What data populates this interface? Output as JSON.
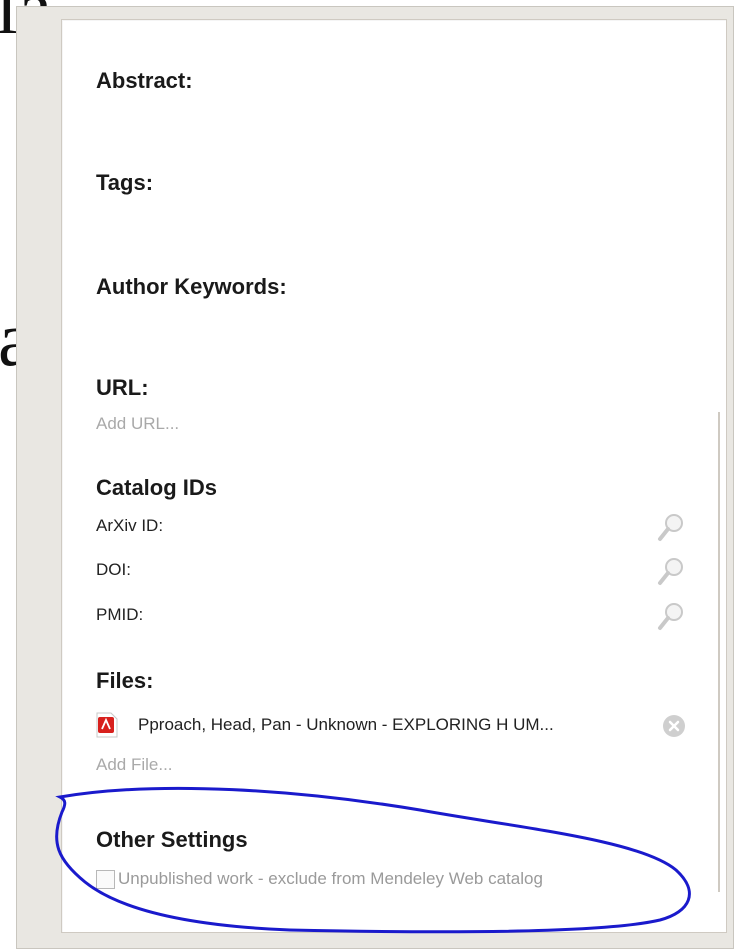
{
  "background": {
    "fragment_top": "la",
    "fragment_mid": "a"
  },
  "panel": {
    "abstract_heading": "Abstract:",
    "tags_heading": "Tags:",
    "author_keywords_heading": "Author Keywords:",
    "url_heading": "URL:",
    "url_placeholder": "Add URL...",
    "catalog_heading": "Catalog IDs",
    "catalog_ids": [
      {
        "label": "ArXiv ID:",
        "icon": "search-icon"
      },
      {
        "label": "DOI:",
        "icon": "search-icon"
      },
      {
        "label": "PMID:",
        "icon": "search-icon"
      }
    ],
    "files_heading": "Files:",
    "file": {
      "name": "Pproach, Head, Pan - Unknown - EXPLORING H UM...",
      "icon": "pdf-icon",
      "remove_icon": "close-circle-icon"
    },
    "add_file_placeholder": "Add File...",
    "other_settings_heading": "Other Settings",
    "unpublished_checkbox": {
      "label": "Unpublished work - exclude from Mendeley Web catalog",
      "checked": false
    }
  },
  "annotation": {
    "color": "#1a1acc"
  }
}
